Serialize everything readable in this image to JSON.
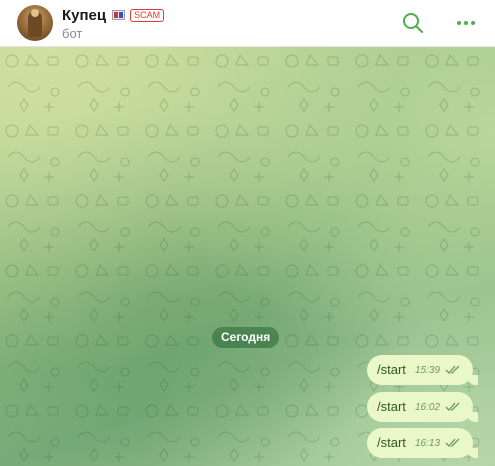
{
  "header": {
    "chat_name": "Купец",
    "badge": "SCAM",
    "subtitle": "бот",
    "icons": [
      "avatar",
      "flag-icon",
      "search-icon",
      "more-icon"
    ]
  },
  "chat": {
    "date_label": "Сегодня",
    "messages": [
      {
        "text": "/start",
        "time": "15:39",
        "status": "read"
      },
      {
        "text": "/start",
        "time": "16:02",
        "status": "read"
      },
      {
        "text": "/start",
        "time": "16:13",
        "status": "read"
      }
    ]
  },
  "colors": {
    "accent": "#4fae4e",
    "scam": "#e53935",
    "bubble": "#eaf7c8",
    "date_pill": "#4c8a56"
  }
}
